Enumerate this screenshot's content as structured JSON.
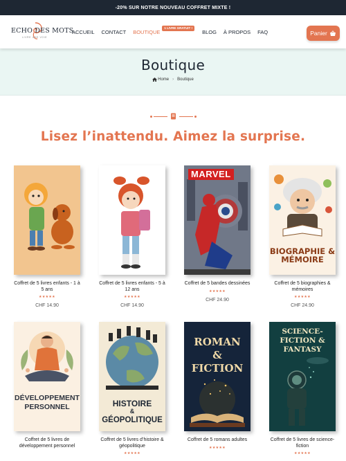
{
  "topbar": {
    "text": "-20% SUR NOTRE NOUVEAU COFFRET MIXTE !"
  },
  "header": {
    "logo_text": "ECHO DES MOTS",
    "logo_sub": "LIVRE UNE VOIE",
    "nav": [
      {
        "label": "ACCUEIL",
        "active": false
      },
      {
        "label": "CONTACT",
        "active": false
      },
      {
        "label": "BOUTIQUE",
        "active": true
      },
      {
        "label": "BLOG",
        "active": false
      },
      {
        "label": "À PROPOS",
        "active": false
      },
      {
        "label": "FAQ",
        "active": false
      }
    ],
    "badge": "1 LIVRE GRATUIT !",
    "cart_label": "Panier"
  },
  "banner": {
    "title": "Boutique",
    "breadcrumb_home": "Home",
    "breadcrumb_current": "Boutique"
  },
  "tagline": "Lisez l’inattendu. Aimez la surprise.",
  "products": [
    {
      "name": "Coffret de 5 livres enfants - 1 à 5 ans",
      "stars": "★★★★★",
      "price": "CHF 14.90"
    },
    {
      "name": "Coffret de 5 livres enfants - 5 à 12 ans",
      "stars": "★★★★★",
      "price": "CHF 14.90"
    },
    {
      "name": "Coffret de 5 bandes dessinées",
      "stars": "★★★★★",
      "price": "CHF 24.90"
    },
    {
      "name": "Coffret de 5 biographies & mémoires",
      "stars": "★★★★★",
      "price": "CHF 24.90"
    },
    {
      "name": "Coffret de 5 livres de développement personnel",
      "stars": "",
      "price": ""
    },
    {
      "name": "Coffret de 5 livres d’histoire & géopolitique",
      "stars": "★★★★★",
      "price": ""
    },
    {
      "name": "Coffret de 5 romans adultes",
      "stars": "★★★★★",
      "price": ""
    },
    {
      "name": "Coffret de 5 livres de science-fiction",
      "stars": "★★★★★",
      "price": ""
    }
  ],
  "covers": {
    "comic_logo": "MARVEL",
    "bio_title": "BIOGRAPHIE & MÉMOIRE",
    "dev_title": "DÉVELOPPEMENT PERSONNEL",
    "hist_title_1": "HISTOIRE",
    "hist_title_2": "&",
    "hist_title_3": "GÉOPOLITIQUE",
    "roman_title": "ROMAN & FICTION",
    "scifi_title": "SCIENCE-FICTION & FANTASY"
  },
  "colors": {
    "accent": "#e37550",
    "dark": "#1e2733",
    "banner_bg": "#eaf6f3"
  }
}
